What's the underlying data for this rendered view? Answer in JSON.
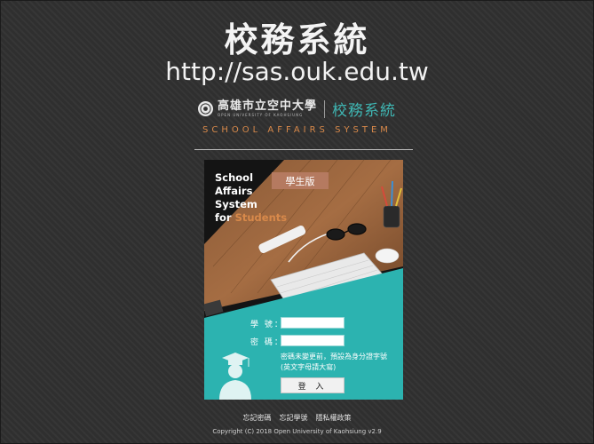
{
  "header": {
    "title": "校務系統",
    "url": "http://sas.ouk.edu.tw"
  },
  "logo": {
    "university_zh": "高雄市立空中大學",
    "university_en": "OPEN UNIVERSITY OF KAOHSIUNG",
    "system_zh": "校務系統",
    "system_en": "SCHOOL AFFAIRS SYSTEM"
  },
  "card": {
    "title_lines": [
      "School",
      "Affairs",
      "System"
    ],
    "title_for": "for",
    "title_students": "Students",
    "badge": "學生版",
    "student_id_label": "學 號：",
    "student_id_value": "",
    "password_label": "密 碼：",
    "password_value": "",
    "hint": "密碼未變更前，預設為身分證字號(英文字母請大寫)",
    "login_label": "登 入"
  },
  "footer": {
    "links": [
      "忘記密碼",
      "忘記學號",
      "隱私權政策"
    ],
    "copyright": "Copyright (C) 2018 Open University of Kaohsiung v2.9"
  },
  "colors": {
    "background": "#2f2f2f",
    "teal": "#3fb6b3",
    "orange": "#d8894a",
    "badge": "#b57a60"
  },
  "icons": [
    "seal-icon",
    "graduate-icon",
    "keyboard-icon",
    "mouse-icon",
    "glasses-icon",
    "pencil-cup-icon"
  ]
}
